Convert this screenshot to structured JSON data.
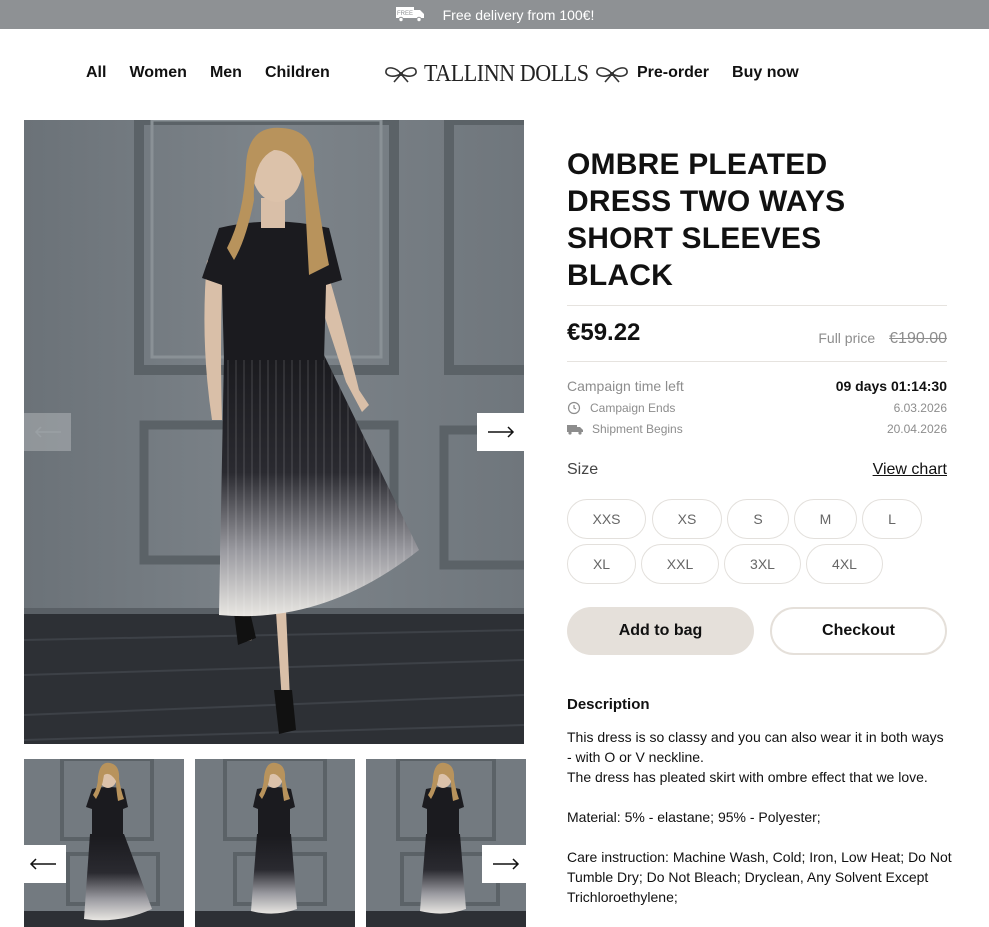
{
  "promo": {
    "badge": "FREE",
    "text": "Free delivery from 100€!"
  },
  "nav": {
    "left": [
      "All",
      "Women",
      "Men",
      "Children"
    ],
    "right": [
      "Pre-order",
      "Buy now"
    ],
    "logo": "TALLINN DOLLS"
  },
  "product": {
    "title_lines": [
      "OMBRE PLEATED",
      "DRESS TWO WAYS",
      "SHORT SLEEVES",
      "BLACK"
    ],
    "price": "€59.22",
    "full_price_label": "Full price",
    "full_price": "€190.00",
    "campaign": {
      "time_left_label": "Campaign time left",
      "time_left": "09 days 01:14:30",
      "ends_label": "Campaign Ends",
      "ends": "6.03.2026",
      "shipment_label": "Shipment Begins",
      "shipment": "20.04.2026"
    },
    "size_label": "Size",
    "view_chart": "View chart",
    "sizes_row1": [
      "XXS",
      "XS",
      "S",
      "M",
      "L"
    ],
    "sizes_row2": [
      "XL",
      "XXL",
      "3XL",
      "4XL"
    ],
    "add_to_bag": "Add to bag",
    "checkout": "Checkout",
    "description_heading": "Description",
    "description": {
      "p1": "This dress is so classy and you can also wear it in both ways - with O or V neckline.",
      "p2": "The dress has pleated skirt with ombre effect that we love.",
      "p3": "Material: 5% - elastane; 95% - Polyester;",
      "p4": "Care instruction: Machine Wash, Cold; Iron, Low Heat; Do Not Tumble Dry; Do Not Bleach; Dryclean, Any Solvent Except Trichloroethylene;"
    }
  },
  "icons": {
    "truck": "truck-icon",
    "timer": "timer-icon",
    "shipment": "shipment-truck-icon",
    "prev": "arrow-left-icon",
    "next": "arrow-right-icon"
  },
  "colors": {
    "promo_bg": "#8e9194",
    "button_bg": "#e5e0da",
    "border": "#e3e0dc",
    "muted": "#8d8d8d"
  }
}
